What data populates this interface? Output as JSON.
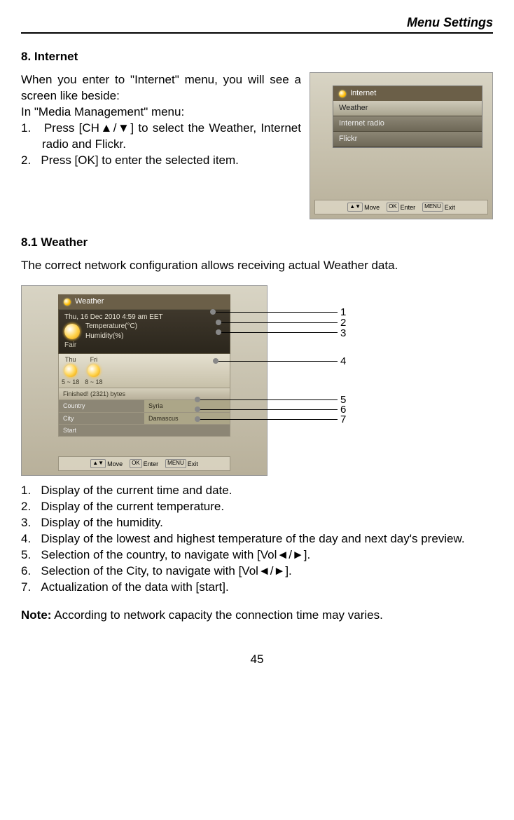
{
  "header": {
    "title": "Menu Settings"
  },
  "section8": {
    "title": "8.  Internet",
    "intro1": "When you enter to \"Internet\" menu, you will see a screen like beside:",
    "intro2": "In \"Media Management\" menu:",
    "steps": [
      "Press [CH▲/▼] to select the Weather, Internet radio and Flickr.",
      "Press [OK] to enter the selected item."
    ]
  },
  "shot1": {
    "title": "Internet",
    "items": [
      "Weather",
      "Internet radio",
      "Flickr"
    ],
    "bottombar": {
      "move": "Move",
      "enter": "Enter",
      "exit": "Exit",
      "move_key": "▲▼",
      "enter_key": "OK",
      "exit_key": "MENU"
    }
  },
  "section81": {
    "title": "8.1  Weather",
    "intro": "The correct network configuration allows receiving actual Weather data."
  },
  "shot2": {
    "title": "Weather",
    "datetime": "Thu, 16 Dec 2010 4:59 am EET",
    "temp_label": "Temperature(°C)",
    "hum_label": "Humidity(%)",
    "fair": "Fair",
    "forecast": [
      {
        "day": "Thu",
        "range": "5 ~ 18"
      },
      {
        "day": "Fri",
        "range": "8 ~ 18"
      }
    ],
    "finished": "Finished! (2321) bytes",
    "rows": [
      {
        "label": "Country",
        "value": "Syria"
      },
      {
        "label": "City",
        "value": "Damascus"
      },
      {
        "label": "Start",
        "value": ""
      }
    ],
    "bottombar": {
      "move": "Move",
      "enter": "Enter",
      "exit": "Exit",
      "move_key": "▲▼",
      "enter_key": "OK",
      "exit_key": "MENU"
    }
  },
  "callout_numbers": [
    "1",
    "2",
    "3",
    "4",
    "5",
    "6",
    "7"
  ],
  "legend": [
    "Display of the current time and date.",
    "Display of the current temperature.",
    "Display of the humidity.",
    "Display of the lowest and highest temperature of the day and next day's preview.",
    "Selection of the country, to navigate with [Vol◄/►].",
    "Selection of the City, to navigate with [Vol◄/►].",
    "Actualization of the data with [start]."
  ],
  "note": {
    "label": "Note:",
    "text": " According to network capacity the connection time may varies."
  },
  "page_number": "45"
}
